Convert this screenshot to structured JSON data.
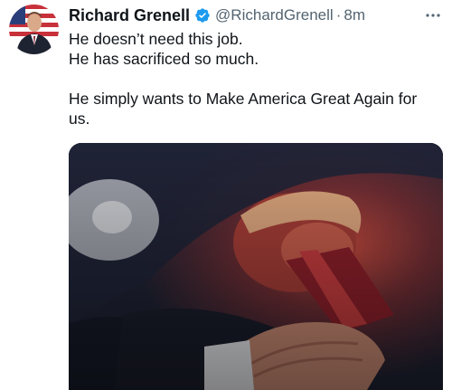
{
  "tweet": {
    "author": {
      "display_name": "Richard Grenell",
      "handle": "@RichardGrenell",
      "verified": true
    },
    "separator": "·",
    "timestamp": "8m",
    "text_lines": [
      "He doesn’t need this job.",
      "He has sacrificed so much.",
      "",
      "He simply wants to Make America Great Again for",
      "us."
    ],
    "media": {
      "type": "photo"
    }
  },
  "icons": {
    "verified": "verified-badge-icon",
    "more": "more-options-icon"
  },
  "colors": {
    "name_text": "#0f1419",
    "secondary_text": "#536471",
    "verified_badge": "#1d9bf0"
  }
}
